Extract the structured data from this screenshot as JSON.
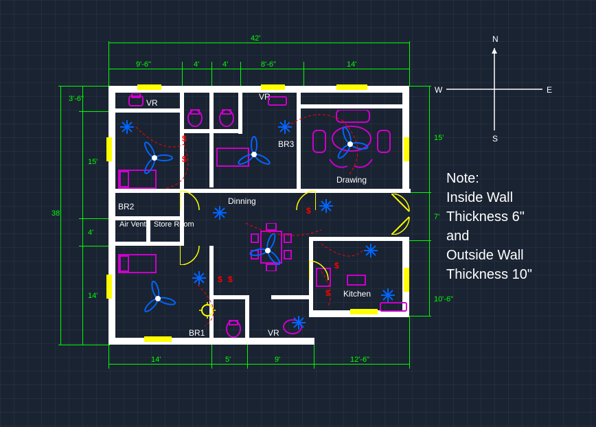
{
  "dimensions": {
    "top_total": "42'",
    "top_seg1": "9'-6\"",
    "top_seg2": "4'",
    "top_seg3": "4'",
    "top_seg4": "8'-6\"",
    "top_seg5": "14'",
    "left_total": "38'",
    "left_seg1": "3'-6\"",
    "left_seg2": "15'",
    "left_seg3": "4'",
    "left_seg4": "14'",
    "right_seg1": "15'",
    "right_seg2": "7'",
    "right_seg3": "10'-6\"",
    "bottom_seg1": "14'",
    "bottom_seg2": "5'",
    "bottom_seg3": "9'",
    "bottom_seg4": "12'-6\""
  },
  "rooms": {
    "vr1": "VR",
    "vr2": "VR",
    "vr3": "VR",
    "br1": "BR1",
    "br2": "BR2",
    "br3": "BR3",
    "dinning": "Dinning",
    "drawing": "Drawing",
    "kitchen": "Kitchen",
    "airvent": "Air Vent",
    "store": "Store Room"
  },
  "note": {
    "title": "Note:",
    "line1": "Inside Wall",
    "line2": "Thickness 6\"",
    "line3": "and",
    "line4": "Outside Wall",
    "line5": "Thickness 10\""
  },
  "compass": {
    "n": "N",
    "s": "S",
    "e": "E",
    "w": "W"
  }
}
